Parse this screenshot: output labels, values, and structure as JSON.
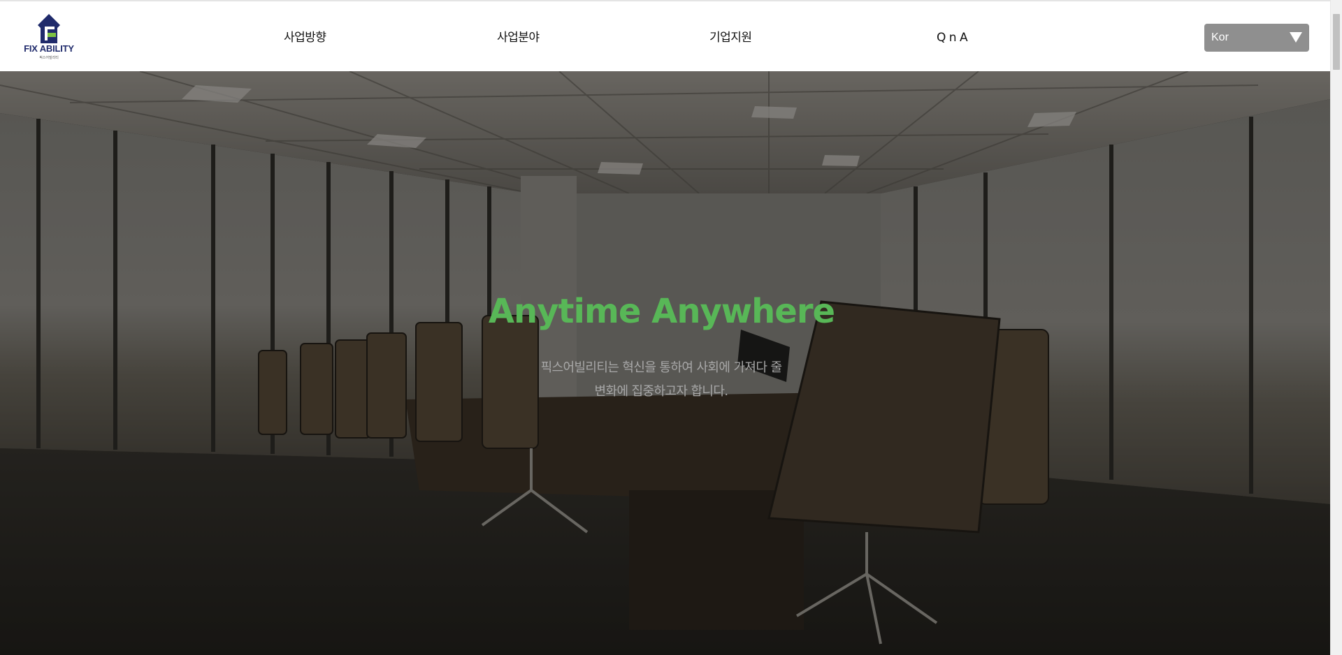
{
  "header": {
    "logo_text": "FIX ABILITY",
    "logo_subtext": "픽스어빌리티",
    "nav": [
      {
        "label": "사업방향"
      },
      {
        "label": "사업분야"
      },
      {
        "label": "기업지원"
      },
      {
        "label": "Q n A"
      }
    ],
    "language_select": {
      "value": "Kor",
      "icon": "triangle-down-icon"
    }
  },
  "hero": {
    "title": "Anytime Anywhere",
    "description_line1": "픽스어빌리티는 혁신을 통하여 사회에 가져다 줄",
    "description_line2": "변화에 집중하고자 합니다.",
    "background_image": "conference-room-photo"
  },
  "colors": {
    "accent_green": "#58b757",
    "logo_navy": "#1f2a6b",
    "logo_green": "#7dc242",
    "select_bg": "#8f8f8f"
  }
}
